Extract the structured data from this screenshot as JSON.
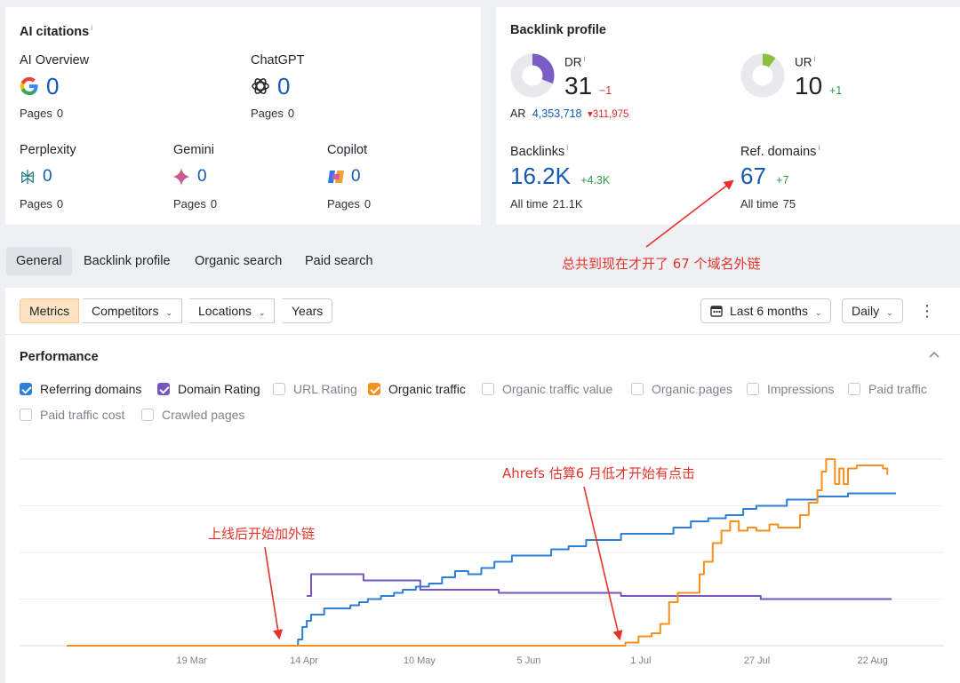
{
  "ai_citations": {
    "title": "AI citations",
    "info": "i",
    "pages_label": "Pages",
    "sources": [
      {
        "name": "AI Overview",
        "value": "0",
        "pages": "0",
        "icon": "google-icon"
      },
      {
        "name": "ChatGPT",
        "value": "0",
        "pages": "0",
        "icon": "chatgpt-icon"
      },
      {
        "name": "Perplexity",
        "value": "0",
        "pages": "0",
        "icon": "perplexity-icon"
      },
      {
        "name": "Gemini",
        "value": "0",
        "pages": "0",
        "icon": "gemini-icon"
      },
      {
        "name": "Copilot",
        "value": "0",
        "pages": "0",
        "icon": "copilot-icon"
      }
    ]
  },
  "backlink_profile": {
    "title": "Backlink profile",
    "info": "i",
    "dr": {
      "label": "DR",
      "value": "31",
      "delta": "−1",
      "fill": 31
    },
    "ur": {
      "label": "UR",
      "value": "10",
      "delta": "+1",
      "fill": 10
    },
    "ar": {
      "label": "AR",
      "value": "4,353,718",
      "delta": "▾311,975"
    },
    "backlinks": {
      "label": "Backlinks",
      "value": "16.2K",
      "delta": "+4.3K",
      "alltime_label": "All time",
      "alltime": "21.1K"
    },
    "ref_domains": {
      "label": "Ref. domains",
      "value": "67",
      "delta": "+7",
      "alltime_label": "All time",
      "alltime": "75"
    }
  },
  "tabs": [
    "General",
    "Backlink profile",
    "Organic search",
    "Paid search"
  ],
  "toolbar": {
    "metrics": "Metrics",
    "competitors": "Competitors",
    "locations": "Locations",
    "years": "Years",
    "range": "Last 6 months",
    "interval": "Daily"
  },
  "performance": {
    "title": "Performance",
    "metrics": [
      {
        "label": "Referring domains",
        "checked": true,
        "color": "#2d7fd6"
      },
      {
        "label": "Domain Rating",
        "checked": true,
        "color": "#7656c0"
      },
      {
        "label": "URL Rating",
        "checked": false
      },
      {
        "label": "Organic traffic",
        "checked": true,
        "color": "#f5901e"
      },
      {
        "label": "Organic traffic value",
        "checked": false
      },
      {
        "label": "Organic pages",
        "checked": false
      },
      {
        "label": "Impressions",
        "checked": false
      },
      {
        "label": "Paid traffic",
        "checked": false
      },
      {
        "label": "Paid traffic cost",
        "checked": false
      },
      {
        "label": "Crawled pages",
        "checked": false
      }
    ]
  },
  "annotations": {
    "ref_domains_note": "总共到现在才开了 67 个域名外链",
    "launch_note": "上线后开始加外链",
    "traffic_note": "Ahrefs 估算6 月低才开始有点击"
  },
  "chart_data": {
    "type": "line",
    "x_ticks": [
      "19 Mar",
      "14 Apr",
      "10 May",
      "5 Jun",
      "1 Jul",
      "27 Jul",
      "22 Aug"
    ],
    "grid": true,
    "series": [
      {
        "name": "Referring domains",
        "color": "#2d7fd6",
        "points": [
          [
            "2025-02-19",
            0
          ],
          [
            "2025-04-12",
            0
          ],
          [
            "2025-04-13",
            2
          ],
          [
            "2025-04-14",
            6
          ],
          [
            "2025-04-15",
            8
          ],
          [
            "2025-04-16",
            10
          ],
          [
            "2025-04-17",
            10
          ],
          [
            "2025-04-19",
            12
          ],
          [
            "2025-04-21",
            12
          ],
          [
            "2025-04-23",
            12
          ],
          [
            "2025-04-25",
            13
          ],
          [
            "2025-04-27",
            14
          ],
          [
            "2025-04-29",
            15
          ],
          [
            "2025-05-02",
            16
          ],
          [
            "2025-05-05",
            17
          ],
          [
            "2025-05-07",
            18
          ],
          [
            "2025-05-10",
            19
          ],
          [
            "2025-05-13",
            20
          ],
          [
            "2025-05-16",
            22
          ],
          [
            "2025-05-19",
            24
          ],
          [
            "2025-05-22",
            23
          ],
          [
            "2025-05-25",
            25
          ],
          [
            "2025-05-28",
            27
          ],
          [
            "2025-06-01",
            29
          ],
          [
            "2025-06-06",
            29
          ],
          [
            "2025-06-10",
            31
          ],
          [
            "2025-06-14",
            32
          ],
          [
            "2025-06-18",
            34
          ],
          [
            "2025-06-22",
            34
          ],
          [
            "2025-06-26",
            36
          ],
          [
            "2025-07-04",
            36
          ],
          [
            "2025-07-08",
            38
          ],
          [
            "2025-07-12",
            40
          ],
          [
            "2025-07-16",
            41
          ],
          [
            "2025-07-20",
            42
          ],
          [
            "2025-07-24",
            44
          ],
          [
            "2025-07-27",
            45
          ],
          [
            "2025-07-31",
            45
          ],
          [
            "2025-08-03",
            47
          ],
          [
            "2025-08-07",
            47
          ],
          [
            "2025-08-10",
            48
          ],
          [
            "2025-08-14",
            48
          ],
          [
            "2025-08-17",
            49
          ],
          [
            "2025-08-28",
            49
          ]
        ]
      },
      {
        "name": "Domain Rating",
        "color": "#7656c0",
        "points": [
          [
            "2025-04-15",
            16
          ],
          [
            "2025-04-16",
            23
          ],
          [
            "2025-04-20",
            23
          ],
          [
            "2025-04-27",
            23
          ],
          [
            "2025-04-28",
            21
          ],
          [
            "2025-05-10",
            21
          ],
          [
            "2025-05-11",
            18
          ],
          [
            "2025-05-28",
            18
          ],
          [
            "2025-05-29",
            17
          ],
          [
            "2025-06-25",
            17
          ],
          [
            "2025-06-26",
            16
          ],
          [
            "2025-07-27",
            16
          ],
          [
            "2025-07-28",
            15
          ],
          [
            "2025-08-27",
            15
          ]
        ]
      },
      {
        "name": "Organic traffic",
        "color": "#f5901e",
        "points": [
          [
            "2025-02-19",
            0
          ],
          [
            "2025-06-26",
            0
          ],
          [
            "2025-06-27",
            1
          ],
          [
            "2025-06-30",
            3
          ],
          [
            "2025-07-03",
            4
          ],
          [
            "2025-07-05",
            7
          ],
          [
            "2025-07-07",
            14
          ],
          [
            "2025-07-09",
            17
          ],
          [
            "2025-07-12",
            17
          ],
          [
            "2025-07-14",
            23
          ],
          [
            "2025-07-15",
            27
          ],
          [
            "2025-07-17",
            33
          ],
          [
            "2025-07-19",
            37
          ],
          [
            "2025-07-21",
            40
          ],
          [
            "2025-07-23",
            37
          ],
          [
            "2025-07-25",
            38
          ],
          [
            "2025-07-27",
            37
          ],
          [
            "2025-07-30",
            39
          ],
          [
            "2025-08-01",
            38
          ],
          [
            "2025-08-04",
            38
          ],
          [
            "2025-08-06",
            42
          ],
          [
            "2025-08-08",
            46
          ],
          [
            "2025-08-10",
            50
          ],
          [
            "2025-08-11",
            56
          ],
          [
            "2025-08-12",
            60
          ],
          [
            "2025-08-13",
            60
          ],
          [
            "2025-08-14",
            52
          ],
          [
            "2025-08-15",
            57
          ],
          [
            "2025-08-16",
            52
          ],
          [
            "2025-08-17",
            57
          ],
          [
            "2025-08-19",
            58
          ],
          [
            "2025-08-23",
            58
          ],
          [
            "2025-08-25",
            57
          ],
          [
            "2025-08-26",
            55
          ]
        ]
      }
    ]
  }
}
